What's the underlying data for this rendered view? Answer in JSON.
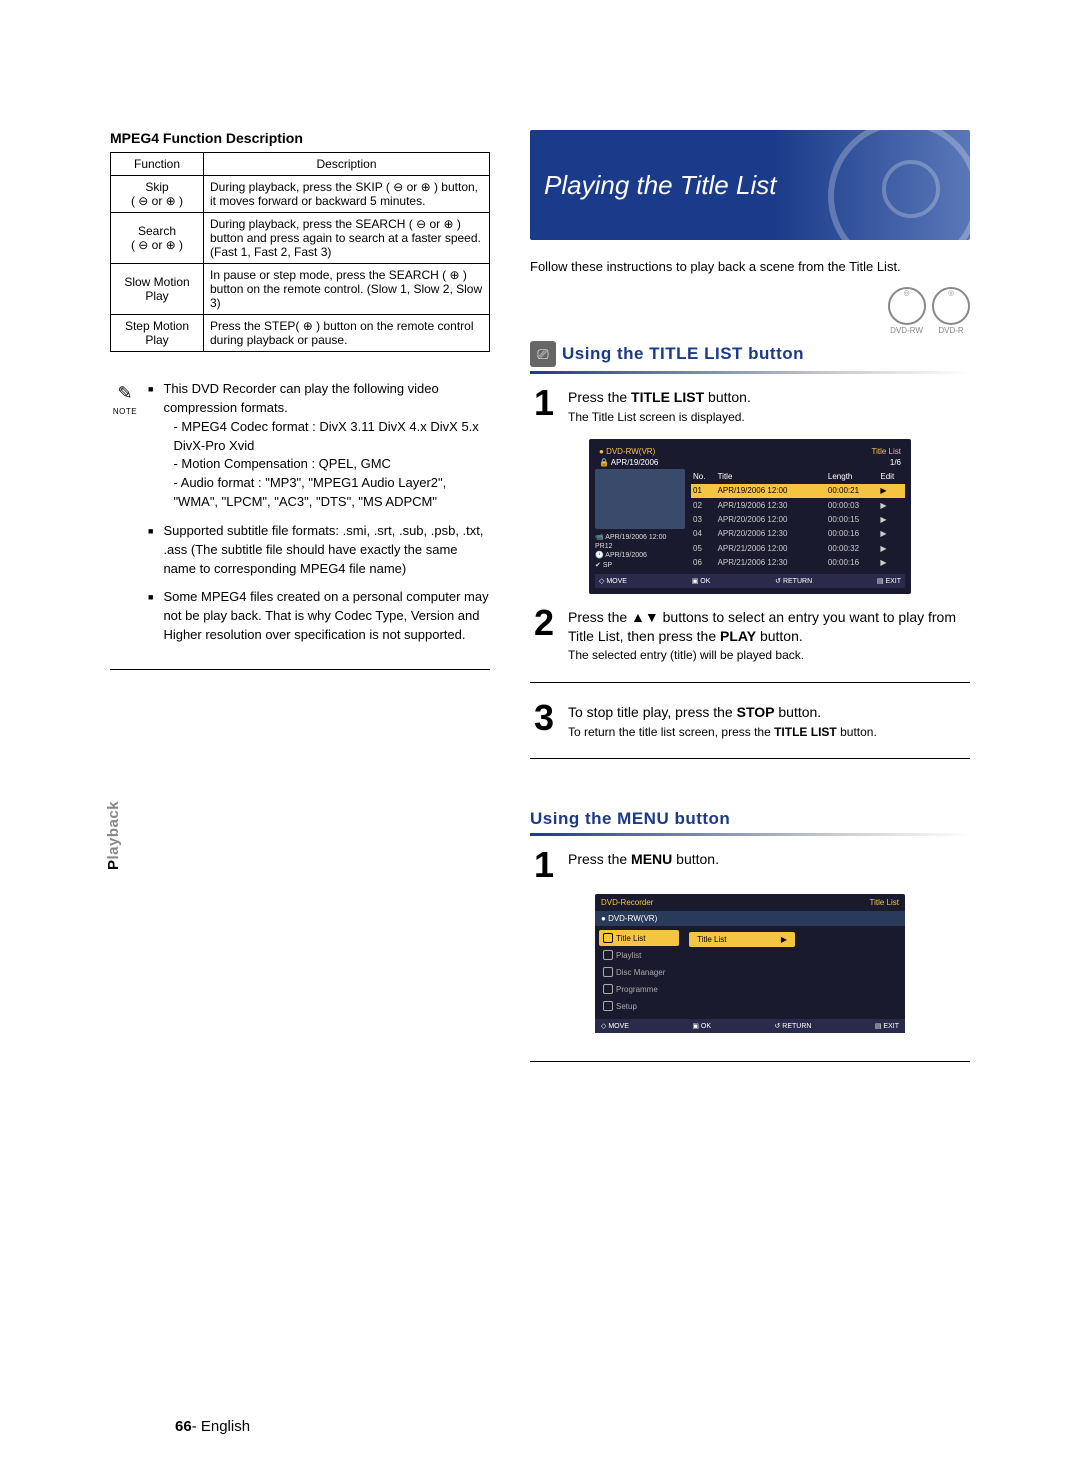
{
  "leftColumn": {
    "tableTitle": "MPEG4 Function Description",
    "headers": {
      "c1": "Function",
      "c2": "Description"
    },
    "rows": [
      {
        "fn": "Skip",
        "fn2": "( ⊖ or ⊕ )",
        "desc": "During playback, press the SKIP ( ⊖ or ⊕ ) button, it moves forward or backward 5 minutes."
      },
      {
        "fn": "Search",
        "fn2": "( ⊖ or ⊕ )",
        "desc": "During playback, press the SEARCH ( ⊖ or ⊕ ) button and press again to search at a faster speed. (Fast 1, Fast 2, Fast 3)"
      },
      {
        "fn": "Slow Motion Play",
        "fn2": "",
        "desc": "In pause or step mode, press the SEARCH ( ⊕ ) button on the remote control. (Slow 1, Slow 2, Slow 3)"
      },
      {
        "fn": "Step Motion Play",
        "fn2": "",
        "desc": "Press the STEP( ⊕ ) button on the remote control during playback or pause."
      }
    ],
    "noteLabel": "NOTE",
    "note1a": "This DVD Recorder can play the following video compression formats.",
    "note1b": "- MPEG4 Codec format : DivX 3.11 DivX 4.x DivX 5.x DivX-Pro Xvid",
    "note1c": "- Motion Compensation : QPEL, GMC",
    "note1d": "- Audio format : \"MP3\", \"MPEG1 Audio Layer2\", \"WMA\", \"LPCM\", \"AC3\", \"DTS\", \"MS ADPCM\"",
    "note2": "Supported subtitle file formats: .smi, .srt, .sub, .psb, .txt, .ass (The subtitle file should have exactly the same name to corresponding MPEG4 file name)",
    "note3": "Some MPEG4 files created on a personal computer may not be play back. That is why Codec Type, Version and Higher resolution over specification is not supported."
  },
  "rightColumn": {
    "banner": "Playing the Title List",
    "intro": "Follow these instructions to play back a scene from the Title List.",
    "discs": [
      "DVD-RW",
      "DVD-R"
    ],
    "sub1": "Using the TITLE LIST button",
    "step1": {
      "main": "Press the TITLE LIST button.",
      "bold": "TITLE LIST",
      "sub": "The Title List screen is displayed."
    },
    "screen1": {
      "discType": "DVD-RW(VR)",
      "title": "Title List",
      "date": "APR/19/2006",
      "count": "1/6",
      "cols": {
        "c1": "No.",
        "c2": "Title",
        "c3": "Length",
        "c4": "Edit"
      },
      "rows": [
        {
          "n": "01",
          "t": "APR/19/2006 12:00",
          "l": "00:00:21",
          "e": "▶"
        },
        {
          "n": "02",
          "t": "APR/19/2006 12:30",
          "l": "00:00:03",
          "e": "▶"
        },
        {
          "n": "03",
          "t": "APR/20/2006 12:00",
          "l": "00:00:15",
          "e": "▶"
        },
        {
          "n": "04",
          "t": "APR/20/2006 12:30",
          "l": "00:00:16",
          "e": "▶"
        },
        {
          "n": "05",
          "t": "APR/21/2006 12:00",
          "l": "00:00:32",
          "e": "▶"
        },
        {
          "n": "06",
          "t": "APR/21/2006 12:30",
          "l": "00:00:16",
          "e": "▶"
        }
      ],
      "info1": "APR/19/2006 12:00 PR12",
      "info2": "APR/19/2006",
      "info3": "SP",
      "ftr": {
        "a": "MOVE",
        "b": "OK",
        "c": "RETURN",
        "d": "EXIT"
      }
    },
    "step2": {
      "main": "Press the ▲▼ buttons to select an entry you want to play from Title List, then press the PLAY button.",
      "sub": "The selected entry (title) will be played back."
    },
    "step3": {
      "main": "To stop title play, press the STOP button.",
      "sub": "To return the title list screen, press the TITLE LIST button."
    },
    "sub2": "Using the MENU button",
    "step1b": {
      "main": "Press the MENU button."
    },
    "screen2": {
      "topL": "DVD-Recorder",
      "topR": "Title List",
      "row2": "DVD-RW(VR)",
      "menu": [
        "Title List",
        "Playlist",
        "Disc Manager",
        "Programme",
        "Setup"
      ],
      "sel": "Title List",
      "ftr": {
        "a": "MOVE",
        "b": "OK",
        "c": "RETURN",
        "d": "EXIT"
      }
    }
  },
  "sideTab": {
    "pre": "P",
    "rest": "layback"
  },
  "footer": {
    "page": "66",
    "sep": "- ",
    "lang": "English"
  }
}
